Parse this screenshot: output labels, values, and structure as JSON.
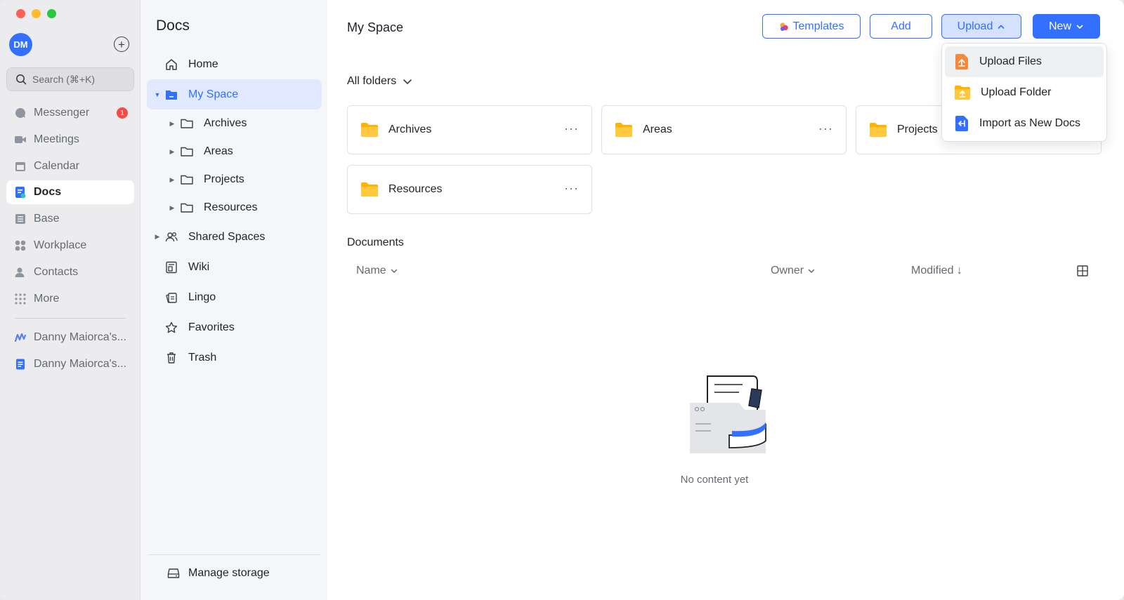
{
  "rail": {
    "avatar_initials": "DM",
    "search_placeholder": "Search (⌘+K)",
    "items": [
      {
        "label": "Messenger",
        "icon": "messenger-icon",
        "badge": "1"
      },
      {
        "label": "Meetings",
        "icon": "video-icon"
      },
      {
        "label": "Calendar",
        "icon": "calendar-icon"
      },
      {
        "label": "Docs",
        "icon": "docs-icon",
        "active": true
      },
      {
        "label": "Base",
        "icon": "base-icon"
      },
      {
        "label": "Workplace",
        "icon": "workplace-icon"
      },
      {
        "label": "Contacts",
        "icon": "contacts-icon"
      },
      {
        "label": "More",
        "icon": "more-grid-icon"
      }
    ],
    "recent": [
      {
        "label": "Danny Maiorca's..."
      },
      {
        "label": "Danny Maiorca's..."
      }
    ]
  },
  "sidebar": {
    "title": "Docs",
    "items": [
      {
        "label": "Home"
      },
      {
        "label": "My Space"
      },
      {
        "label": "Archives"
      },
      {
        "label": "Areas"
      },
      {
        "label": "Projects"
      },
      {
        "label": "Resources"
      },
      {
        "label": "Shared Spaces"
      },
      {
        "label": "Wiki"
      },
      {
        "label": "Lingo"
      },
      {
        "label": "Favorites"
      },
      {
        "label": "Trash"
      }
    ],
    "manage_storage": "Manage storage"
  },
  "main": {
    "title": "My Space",
    "buttons": {
      "templates": "Templates",
      "add": "Add",
      "upload": "Upload",
      "new": "New"
    },
    "all_folders": "All folders",
    "folders": [
      {
        "name": "Archives"
      },
      {
        "name": "Areas"
      },
      {
        "name": "Projects"
      },
      {
        "name": "Resources"
      }
    ],
    "documents_heading": "Documents",
    "columns": {
      "name": "Name",
      "owner": "Owner",
      "modified": "Modified ↓"
    },
    "empty_text": "No content yet"
  },
  "upload_menu": {
    "items": [
      {
        "label": "Upload Files"
      },
      {
        "label": "Upload Folder"
      },
      {
        "label": "Import as New Docs"
      }
    ]
  },
  "colors": {
    "accent": "#3370ff",
    "active_bg": "#e0e9ff",
    "folder": "#ffc60a",
    "badge": "#f54a45"
  }
}
